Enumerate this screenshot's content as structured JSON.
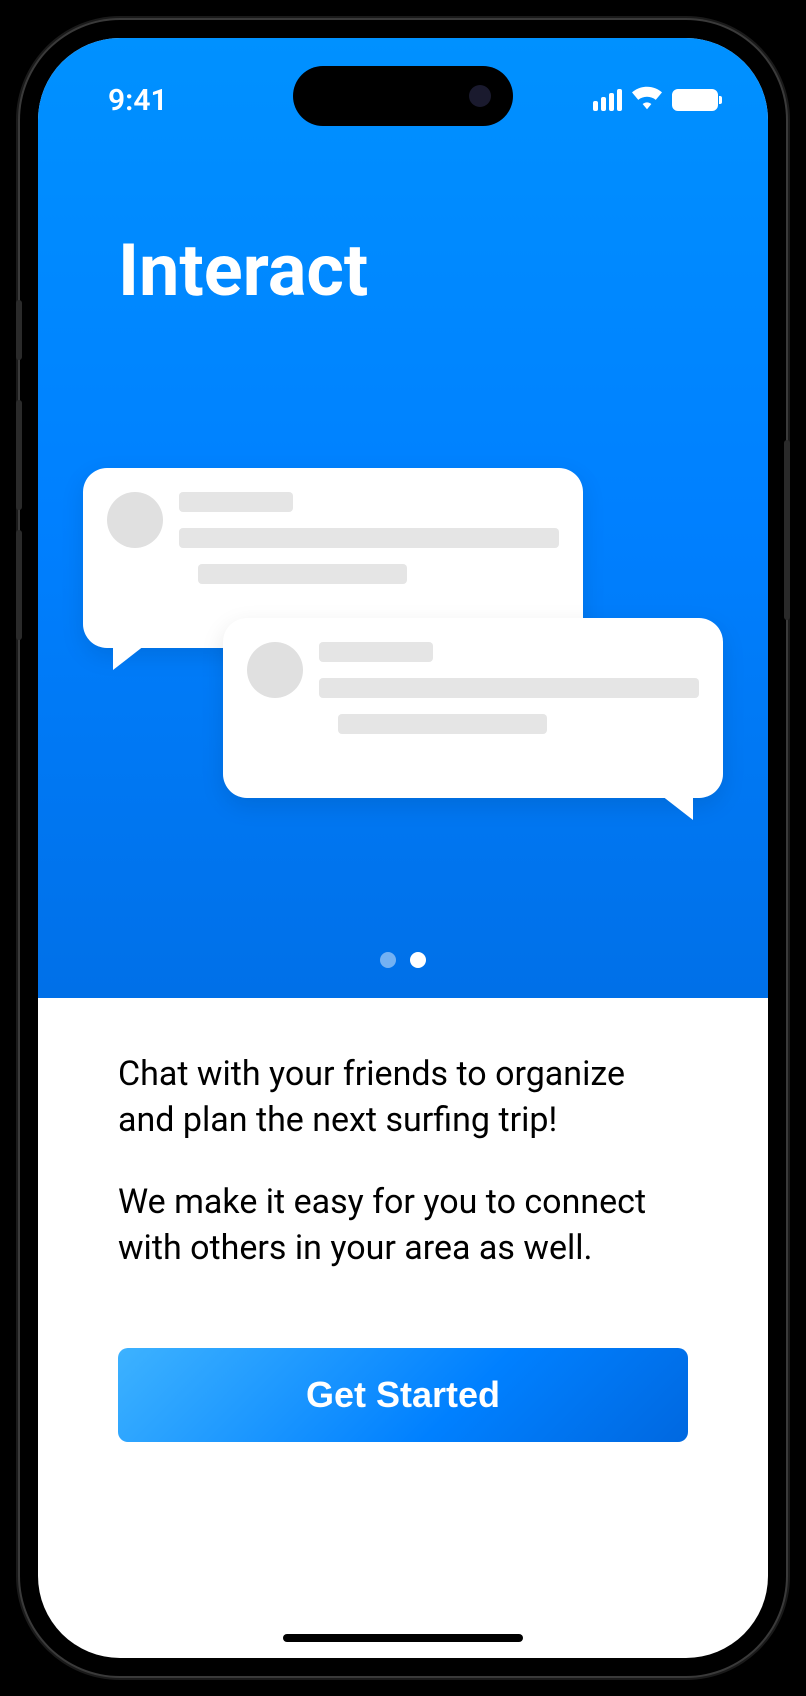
{
  "status_bar": {
    "time": "9:41"
  },
  "hero": {
    "title": "Interact"
  },
  "pagination": {
    "total": 2,
    "active_index": 1
  },
  "content": {
    "paragraph1": "Chat with your friends to organize and plan the next surfing trip!",
    "paragraph2": "We make it easy for you to connect with others in your area as well."
  },
  "cta": {
    "label": "Get Started"
  }
}
